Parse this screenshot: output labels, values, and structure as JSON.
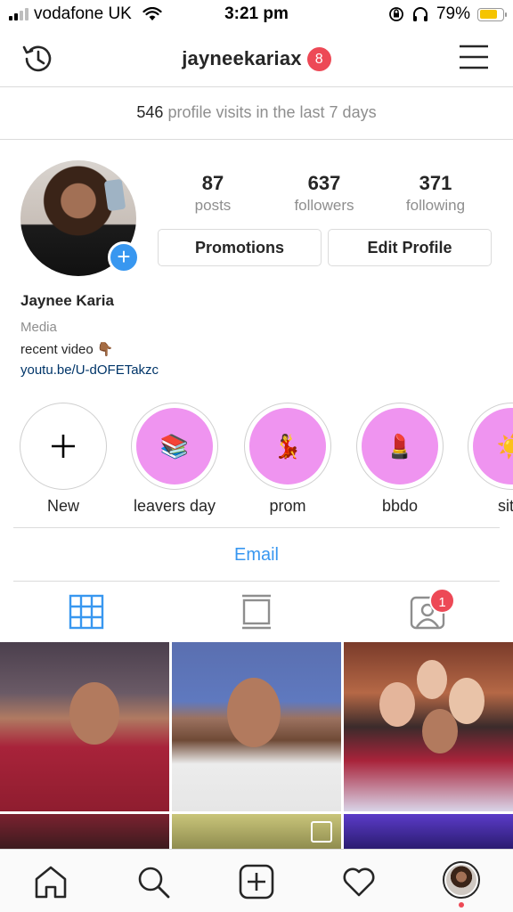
{
  "status_bar": {
    "carrier": "vodafone UK",
    "time": "3:21 pm",
    "battery_percent": "79%",
    "battery_level": 0.79,
    "icons": [
      "signal-icon",
      "wifi-icon",
      "rotation-lock-icon",
      "headphones-icon",
      "battery-icon"
    ]
  },
  "header": {
    "username": "jayneekariax",
    "notification_count": "8",
    "left_icon": "archive-history-icon",
    "right_icon": "hamburger-menu-icon"
  },
  "insights": {
    "visits_count": "546",
    "visits_text": "profile visits in the last 7 days"
  },
  "profile": {
    "posts_count": "87",
    "posts_label": "posts",
    "followers_count": "637",
    "followers_label": "followers",
    "following_count": "371",
    "following_label": "following",
    "promotions_label": "Promotions",
    "edit_profile_label": "Edit Profile",
    "name": "Jaynee Karia",
    "category": "Media",
    "bio": "recent video 👇🏾",
    "link": "youtu.be/U-dOFETakzc"
  },
  "highlights": [
    {
      "label": "New",
      "emoji": "+"
    },
    {
      "label": "leavers day",
      "emoji": "📚"
    },
    {
      "label": "prom",
      "emoji": "💃"
    },
    {
      "label": "bbdo",
      "emoji": "💄"
    },
    {
      "label": "sit",
      "emoji": "☀️"
    }
  ],
  "contact": {
    "email_label": "Email"
  },
  "tabs": {
    "active": "grid",
    "items": [
      "grid-icon",
      "feed-list-icon",
      "tagged-icon"
    ],
    "tagged_badge": "1"
  },
  "colors": {
    "accent": "#3897f0",
    "badge": "#ed4956",
    "highlight_fill": "#ef94f0",
    "link": "#003569"
  },
  "bottom_nav": [
    "home-icon",
    "search-icon",
    "add-post-icon",
    "activity-heart-icon",
    "profile-avatar"
  ]
}
